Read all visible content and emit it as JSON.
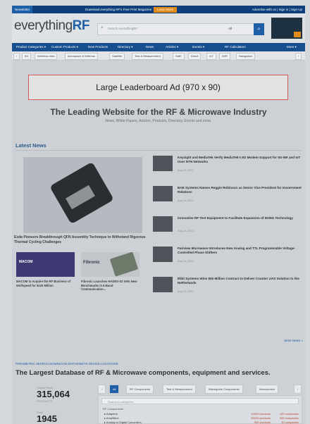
{
  "topbar": {
    "newsletter": "Newsletter",
    "promo": "Download everything RF's Free Print Magazine",
    "learn_more": "Learn More",
    "right_links": "Advertise with us | Sign in | Sign Up"
  },
  "header": {
    "logo_prefix": "everything",
    "logo_suffix": "RF",
    "search_placeholder": "Search everythingRF",
    "search_scope": "All"
  },
  "main_nav": [
    "Product Categories ▾",
    "Custom Products ▾",
    "New Products",
    "Directory ▾",
    "News",
    "Articles ▾",
    "Events ▾",
    "RF Calculators",
    "More ▾"
  ],
  "category_nav": [
    "‹",
    "5G",
    "Wireless Infra",
    "Aerospace & Defense",
    "Satellite",
    "Test & Measurement",
    "SatE",
    "Direct",
    "IoT",
    "WiFi",
    "Navigation",
    "›"
  ],
  "ad": {
    "label": "Large Leaderboard Ad (970 x 90)"
  },
  "hero": {
    "title": "The Leading Website for the RF & Microwave Industry",
    "subtitle": "News, White Papers, Articles, Products, Directory, Events and more."
  },
  "latest_news": {
    "title": "Latest News",
    "featured_caption": "Exda Pioneers Breakthrough QFN Assembly Technique to Withstand Rigorous Thermal Cycling Challenges",
    "cards": [
      {
        "logo": "MACOM",
        "caption": "MACOM to Acquire the RF Business of Wolfspeed for $125 Million"
      },
      {
        "logo": "Fibronic",
        "caption": "Fibronic Launches HADES-S2 Sets New Benchmarks in 6-Band Communication..."
      }
    ],
    "items": [
      {
        "title": "Keysight and MediaTek Verify MediaTek's 5G Modem Support for 5G-NR and IoT Over NTN Networks",
        "date": "Aug 24, 2023"
      },
      {
        "title": "BAE Systems Names Reggie Robinson as Senior Vice President for Government Relations",
        "date": "Aug 24, 2023"
      },
      {
        "title": "innovative RF Test Equipment to Facilitate Expansion of 5G/6G Technology",
        "date": "Aug 24, 2023"
      },
      {
        "title": "Fairview Microwave Introduces New Analog and TTL Programmable Voltage-Controlled Phase Shifters",
        "date": "Aug 24, 2023"
      },
      {
        "title": "Elbit Systems Wins $50 Million Contract to Deliver Counter UAS Solution to the Netherlands",
        "date": "Aug 23, 2023"
      }
    ],
    "more_link": "More News »"
  },
  "database": {
    "tags": "PARAMETRIC SEARCH   DOWNLOAD DATASHEETS   DEVICE LOCATIONS",
    "title": "The Largest Database of RF & Microwave components, equipment and services.",
    "stats": [
      {
        "label": "Unified Parts",
        "value": "315,064",
        "sub": "PRODUCTS"
      },
      {
        "label": "From",
        "value": "1945",
        "sub": ""
      }
    ],
    "tabs": [
      "‹",
      "All",
      "RF Components",
      "Test & Measurement",
      "Waveguide Components",
      "Interconnect",
      "›"
    ],
    "search_placeholder": "Search in categories",
    "panel_heading": "RF Components",
    "rows": [
      {
        "name": "▸ Adapters",
        "products": "10000 products",
        "companies": "100 companies"
      },
      {
        "name": "▸ Amplifiers",
        "products": "50000 products",
        "companies": "300 companies"
      },
      {
        "name": "▸ Analog to Digital Converters",
        "products": "900 products",
        "companies": "40 companies"
      }
    ]
  }
}
